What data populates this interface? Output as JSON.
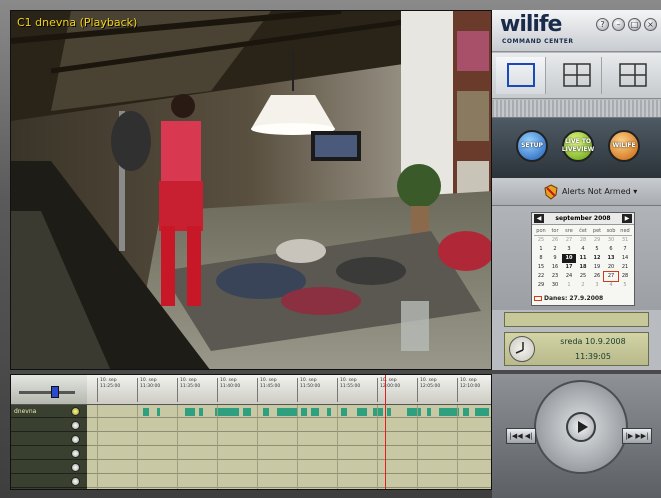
{
  "video": {
    "camera_label": "C1 dnevna (Playback)"
  },
  "header": {
    "logo": "wilife",
    "logo_sub": "COMMAND CENTER",
    "window_buttons": [
      "help-icon",
      "minimize-icon",
      "restore-icon",
      "close-icon"
    ]
  },
  "layouts": [
    {
      "name": "single-view",
      "icon": "single-grid-icon"
    },
    {
      "name": "quad-view",
      "icon": "quad-grid-icon"
    },
    {
      "name": "multi-view",
      "icon": "multi-grid-icon"
    }
  ],
  "modes": [
    {
      "label": "SETUP",
      "color": "#2a78d8"
    },
    {
      "label": "LIVE TO LIVEVIEW",
      "color": "#8ad018"
    },
    {
      "label": "WILIFE",
      "color": "#f08a18"
    }
  ],
  "alerts": {
    "text": "Alerts Not Armed"
  },
  "calendar": {
    "month": "september 2008",
    "weekdays": [
      "pon",
      "tor",
      "sre",
      "čet",
      "pet",
      "sob",
      "ned"
    ],
    "weeks": [
      [
        {
          "d": "25",
          "dim": true
        },
        {
          "d": "26",
          "dim": true
        },
        {
          "d": "27",
          "dim": true
        },
        {
          "d": "28",
          "dim": true
        },
        {
          "d": "29",
          "dim": true
        },
        {
          "d": "30",
          "dim": true
        },
        {
          "d": "31",
          "dim": true
        }
      ],
      [
        {
          "d": "1"
        },
        {
          "d": "2"
        },
        {
          "d": "3"
        },
        {
          "d": "4"
        },
        {
          "d": "5"
        },
        {
          "d": "6"
        },
        {
          "d": "7"
        }
      ],
      [
        {
          "d": "8"
        },
        {
          "d": "9"
        },
        {
          "d": "10",
          "today": true
        },
        {
          "d": "11",
          "bold": true
        },
        {
          "d": "12",
          "bold": true
        },
        {
          "d": "13",
          "bold": true
        },
        {
          "d": "14"
        }
      ],
      [
        {
          "d": "15"
        },
        {
          "d": "16"
        },
        {
          "d": "17",
          "bold": true
        },
        {
          "d": "18",
          "bold": true
        },
        {
          "d": "19"
        },
        {
          "d": "20"
        },
        {
          "d": "21"
        }
      ],
      [
        {
          "d": "22"
        },
        {
          "d": "23"
        },
        {
          "d": "24"
        },
        {
          "d": "25"
        },
        {
          "d": "26"
        },
        {
          "d": "27",
          "sel": true
        },
        {
          "d": "28"
        }
      ],
      [
        {
          "d": "29"
        },
        {
          "d": "30"
        },
        {
          "d": "1",
          "dim": true
        },
        {
          "d": "2",
          "dim": true
        },
        {
          "d": "3",
          "dim": true
        },
        {
          "d": "4",
          "dim": true
        },
        {
          "d": "5",
          "dim": true
        }
      ]
    ],
    "today_label": "Danes: 27.9.2008"
  },
  "clock": {
    "date": "sreda  10.9.2008",
    "time": "11:39:05"
  },
  "timeline": {
    "ticks": [
      [
        "10. sep",
        "11:25:00"
      ],
      [
        "10. sep",
        "11:30:00"
      ],
      [
        "10. sep",
        "11:35:00"
      ],
      [
        "10. sep",
        "11:40:00"
      ],
      [
        "10. sep",
        "11:45:00"
      ],
      [
        "10. sep",
        "11:50:00"
      ],
      [
        "10. sep",
        "11:55:00"
      ],
      [
        "10. sep",
        "12:00:00"
      ],
      [
        "10. sep",
        "12:05:00"
      ],
      [
        "10. sep",
        "12:10:00"
      ]
    ],
    "rows": [
      {
        "label": "dnevna",
        "active": true
      },
      {
        "label": "",
        "active": false
      },
      {
        "label": "",
        "active": false
      },
      {
        "label": "",
        "active": false
      },
      {
        "label": "",
        "active": false
      },
      {
        "label": "",
        "active": false
      }
    ]
  },
  "controls": {
    "rewind_label": "|◀◀ ◀|",
    "forward_label": "|▶ ▶▶|"
  }
}
